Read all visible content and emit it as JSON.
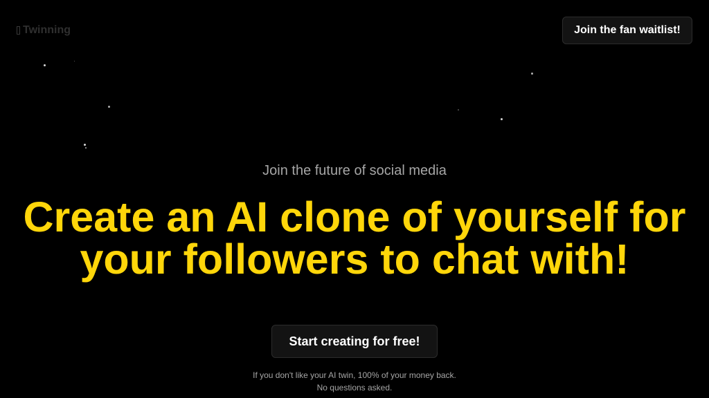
{
  "header": {
    "logo_icon": "apple-icon",
    "logo_text": "Twinning",
    "waitlist_button": "Join the fan waitlist!"
  },
  "hero": {
    "subtitle": "Join the future of social media",
    "headline_line1": "Create an AI clone of yourself for",
    "headline_line2": "your followers to chat with!",
    "cta_button": "Start creating for free!",
    "guarantee_line1": "If you don't like your AI twin, 100% of your money back.",
    "guarantee_line2": "No questions asked."
  },
  "colors": {
    "background": "#000000",
    "headline": "#ffd60a",
    "button_bg": "#131313",
    "muted_text": "#a6a6a6"
  }
}
